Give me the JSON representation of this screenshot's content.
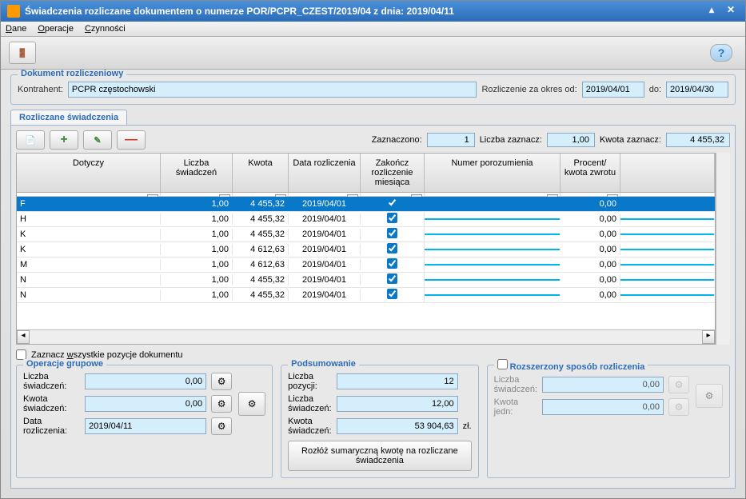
{
  "window": {
    "title": "Świadczenia rozliczane dokumentem o numerze POR/PCPR_CZEST/2019/04 z dnia: 2019/04/11"
  },
  "menu": {
    "dane": "Dane",
    "operacje": "Operacje",
    "czynnosci": "Czynności"
  },
  "dokument": {
    "legend": "Dokument rozliczeniowy",
    "kontrahent_lbl": "Kontrahent:",
    "kontrahent_val": "PCPR częstochowski",
    "okres_lbl": "Rozliczenie za okres od:",
    "okres_od": "2019/04/01",
    "do_lbl": "do:",
    "okres_do": "2019/04/30"
  },
  "tab": {
    "label": "Rozliczane świadczenia"
  },
  "counters": {
    "zaznaczono_lbl": "Zaznaczono:",
    "zaznaczono_val": "1",
    "liczba_lbl": "Liczba zaznacz:",
    "liczba_val": "1,00",
    "kwota_lbl": "Kwota zaznacz:",
    "kwota_val": "4 455,32"
  },
  "grid": {
    "headers": {
      "dotyczy": "Dotyczy",
      "liczba": "Liczba świadczeń",
      "kwota": "Kwota",
      "data": "Data rozliczenia",
      "zakoncz": "Zakończ rozliczenie miesiąca",
      "numer": "Numer porozumienia",
      "procent": "Procent/ kwota zwrotu"
    },
    "rows": [
      {
        "dotyczy": "F",
        "liczba": "1,00",
        "kwota": "4 455,32",
        "data": "2019/04/01",
        "zakoncz": true,
        "numer": "",
        "procent": "0,00",
        "selected": true
      },
      {
        "dotyczy": "H",
        "liczba": "1,00",
        "kwota": "4 455,32",
        "data": "2019/04/01",
        "zakoncz": true,
        "numer": "",
        "procent": "0,00"
      },
      {
        "dotyczy": "K",
        "liczba": "1,00",
        "kwota": "4 455,32",
        "data": "2019/04/01",
        "zakoncz": true,
        "numer": "",
        "procent": "0,00"
      },
      {
        "dotyczy": "K",
        "liczba": "1,00",
        "kwota": "4 612,63",
        "data": "2019/04/01",
        "zakoncz": true,
        "numer": "",
        "procent": "0,00"
      },
      {
        "dotyczy": "M",
        "liczba": "1,00",
        "kwota": "4 612,63",
        "data": "2019/04/01",
        "zakoncz": true,
        "numer": "",
        "procent": "0,00"
      },
      {
        "dotyczy": "N",
        "liczba": "1,00",
        "kwota": "4 455,32",
        "data": "2019/04/01",
        "zakoncz": true,
        "numer": "",
        "procent": "0,00"
      },
      {
        "dotyczy": "N",
        "liczba": "1,00",
        "kwota": "4 455,32",
        "data": "2019/04/01",
        "zakoncz": true,
        "numer": "",
        "procent": "0,00"
      }
    ]
  },
  "check_all": "Zaznacz wszystkie pozycje dokumentu",
  "operacje": {
    "legend": "Operacje grupowe",
    "liczba_lbl": "Liczba świadczeń:",
    "liczba_val": "0,00",
    "kwota_lbl": "Kwota świadczeń:",
    "kwota_val": "0,00",
    "data_lbl": "Data rozliczenia:",
    "data_val": "2019/04/11"
  },
  "podsumowanie": {
    "legend": "Podsumowanie",
    "pozycji_lbl": "Liczba pozycji:",
    "pozycji_val": "12",
    "liczba_lbl": "Liczba świadczeń:",
    "liczba_val": "12,00",
    "kwota_lbl": "Kwota świadczeń:",
    "kwota_val": "53 904,63",
    "zl": "zł.",
    "button": "Rozłóż sumaryczną kwotę na rozliczane świadczenia"
  },
  "rozszerzony": {
    "legend": "Rozszerzony sposób rozliczenia",
    "liczba_lbl": "Liczba świadczeń:",
    "liczba_val": "0,00",
    "kwota_lbl": "Kwota jedn:",
    "kwota_val": "0,00"
  }
}
